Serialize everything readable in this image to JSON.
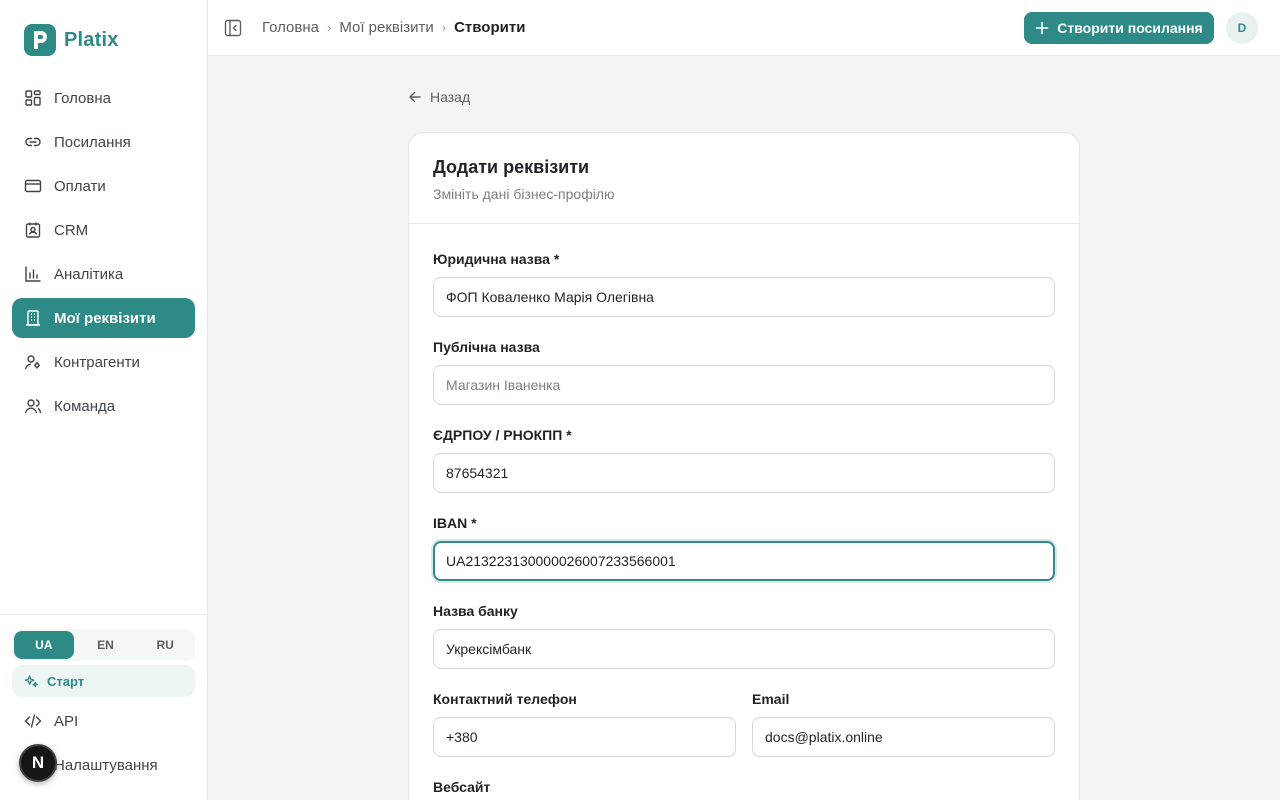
{
  "brand": {
    "name": "Platix",
    "accent": "#2e8a87"
  },
  "sidebar": {
    "items": [
      {
        "label": "Головна",
        "icon": "dashboard-icon"
      },
      {
        "label": "Посилання",
        "icon": "link-icon"
      },
      {
        "label": "Оплати",
        "icon": "credit-card-icon"
      },
      {
        "label": "CRM",
        "icon": "contact-card-icon"
      },
      {
        "label": "Аналітика",
        "icon": "bar-chart-icon"
      },
      {
        "label": "Мої реквізити",
        "icon": "building-icon",
        "active": true
      },
      {
        "label": "Контрагенти",
        "icon": "user-settings-icon"
      },
      {
        "label": "Команда",
        "icon": "users-icon"
      }
    ],
    "languages": [
      "UA",
      "EN",
      "RU"
    ],
    "active_language": "UA",
    "start_label": "Старт",
    "api_label": "API",
    "settings_label": "Налаштування",
    "fab_letter": "N"
  },
  "header": {
    "breadcrumbs": [
      "Головна",
      "Мої реквізити",
      "Створити"
    ],
    "create_label": "Створити посилання",
    "avatar_initial": "D"
  },
  "main": {
    "back_label": "Назад",
    "card": {
      "title": "Додати реквізити",
      "subtitle": "Змініть дані бізнес-профілю"
    },
    "fields": {
      "legal_name": {
        "label": "Юридична назва *",
        "value": "ФОП Коваленко Марія Олегівна"
      },
      "public_name": {
        "label": "Публічна назва",
        "value": "",
        "placeholder": "Магазин Іваненка"
      },
      "edrpou": {
        "label": "ЄДРПОУ / РНОКПП *",
        "value": "87654321"
      },
      "iban": {
        "label": "IBAN *",
        "value": "UA213223130000026007233566001"
      },
      "bank": {
        "label": "Назва банку",
        "value": "Укрексімбанк"
      },
      "phone": {
        "label": "Контактний телефон",
        "value": "+380"
      },
      "email": {
        "label": "Email",
        "value": "docs@platix.online"
      },
      "website": {
        "label": "Вебсайт"
      }
    }
  }
}
